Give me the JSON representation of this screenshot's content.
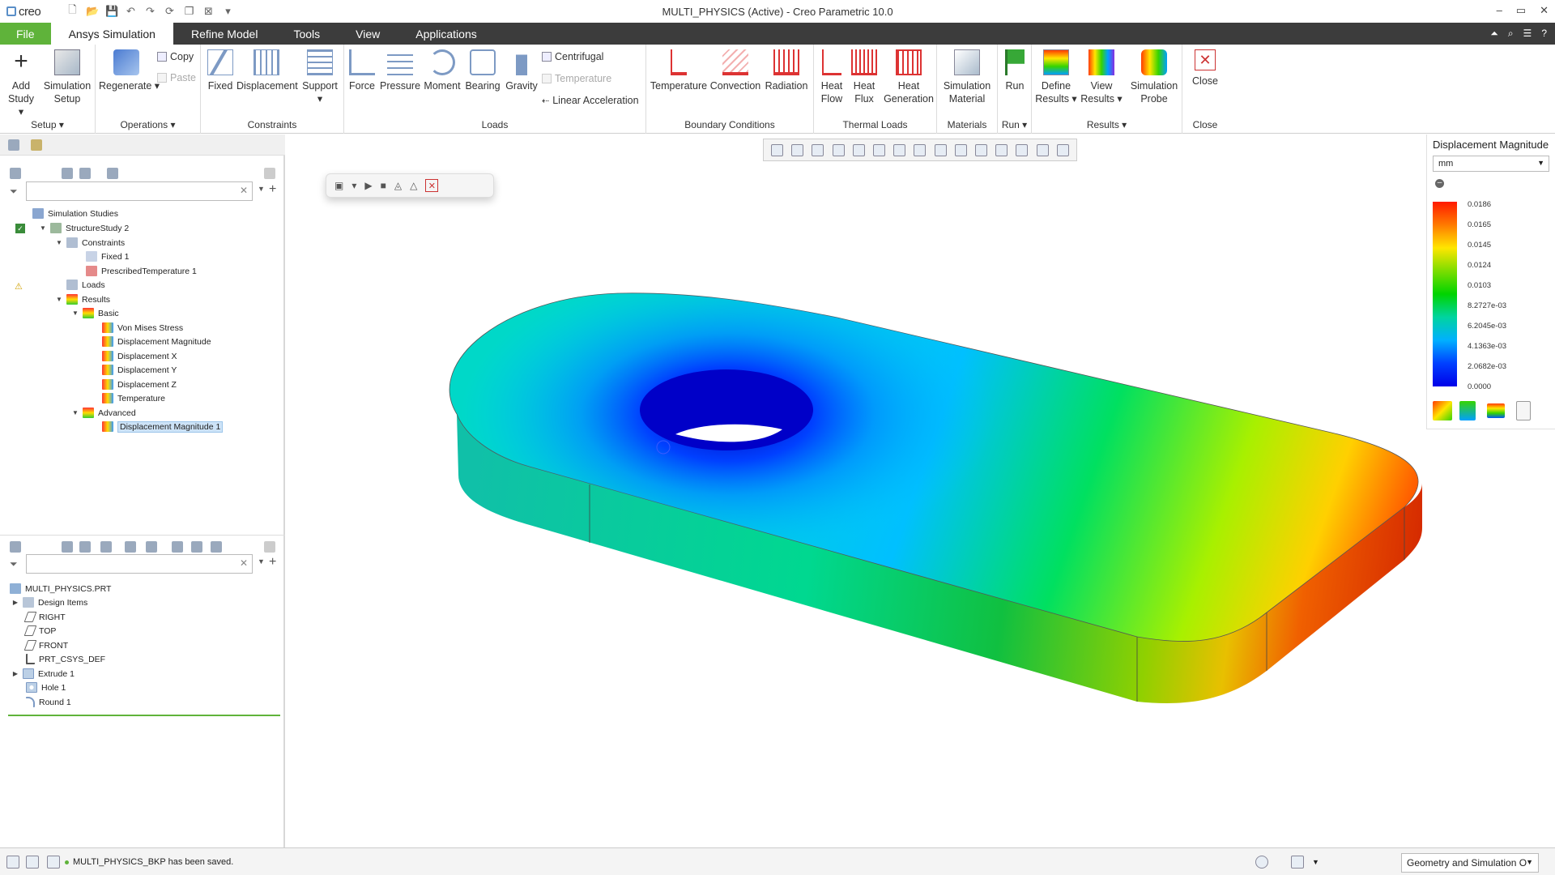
{
  "titlebar": {
    "logo": "creo",
    "title": "MULTI_PHYSICS (Active) - Creo Parametric 10.0",
    "window_controls": [
      "–",
      "▭",
      "✕"
    ]
  },
  "menubar": {
    "tabs": [
      "File",
      "Ansys Simulation",
      "Refine Model",
      "Tools",
      "View",
      "Applications"
    ],
    "active_tab": "Ansys Simulation"
  },
  "ribbon": {
    "setup": {
      "label": "Setup ▾",
      "add_study": "Add Study ▾",
      "simulation_setup": "Simulation Setup"
    },
    "operations": {
      "label": "Operations ▾",
      "regenerate": "Regenerate ▾",
      "copy": "Copy",
      "paste": "Paste"
    },
    "constraints": {
      "label": "Constraints",
      "fixed": "Fixed",
      "displacement": "Displacement",
      "support": "Support ▾"
    },
    "loads": {
      "label": "Loads",
      "force": "Force",
      "pressure": "Pressure",
      "moment": "Moment",
      "bearing": "Bearing",
      "gravity": "Gravity",
      "centrifugal": "Centrifugal",
      "temperature": "Temperature",
      "linear_acceleration": "Linear Acceleration"
    },
    "boundary_conditions": {
      "label": "Boundary Conditions",
      "temperature": "Temperature",
      "convection": "Convection",
      "radiation": "Radiation"
    },
    "thermal_loads": {
      "label": "Thermal Loads",
      "heat_flow": "Heat Flow",
      "heat_flux": "Heat Flux",
      "heat_generation": "Heat Generation"
    },
    "materials": {
      "label": "Materials",
      "simulation_material": "Simulation Material"
    },
    "run": {
      "label": "Run ▾",
      "run": "Run"
    },
    "results": {
      "label": "Results ▾",
      "define_results": "Define Results ▾",
      "view_results": "View Results ▾",
      "simulation_probe": "Simulation Probe"
    },
    "close": {
      "label": "Close",
      "close": "Close"
    }
  },
  "study_tree": {
    "items": [
      {
        "label": "Simulation Studies"
      },
      {
        "label": "StructureStudy 2"
      },
      {
        "label": "Constraints"
      },
      {
        "label": "Fixed 1"
      },
      {
        "label": "PrescribedTemperature 1"
      },
      {
        "label": "Loads"
      },
      {
        "label": "Results"
      },
      {
        "label": "Basic"
      },
      {
        "label": "Von Mises Stress"
      },
      {
        "label": "Displacement Magnitude"
      },
      {
        "label": "Displacement X"
      },
      {
        "label": "Displacement Y"
      },
      {
        "label": "Displacement Z"
      },
      {
        "label": "Temperature"
      },
      {
        "label": "Advanced"
      },
      {
        "label": "Displacement Magnitude 1"
      }
    ]
  },
  "model_tree": {
    "items": [
      {
        "label": "MULTI_PHYSICS.PRT"
      },
      {
        "label": "Design Items"
      },
      {
        "label": "RIGHT"
      },
      {
        "label": "TOP"
      },
      {
        "label": "FRONT"
      },
      {
        "label": "PRT_CSYS_DEF"
      },
      {
        "label": "Extrude 1"
      },
      {
        "label": "Hole 1"
      },
      {
        "label": "Round 1"
      }
    ]
  },
  "legend": {
    "title": "Displacement Magnitude",
    "unit": "mm",
    "values": [
      "0.0186",
      "0.0165",
      "0.0145",
      "0.0124",
      "0.0103",
      "8.2727e-03",
      "6.2045e-03",
      "4.1363e-03",
      "2.0682e-03",
      "0.0000"
    ]
  },
  "status": {
    "message": "MULTI_PHYSICS_BKP has been saved.",
    "filter": "Geometry and Simulation O"
  },
  "colors": {
    "file_tab": "#5fb33a",
    "menubar": "#3c3c3c",
    "selection": "#cde3f7"
  }
}
